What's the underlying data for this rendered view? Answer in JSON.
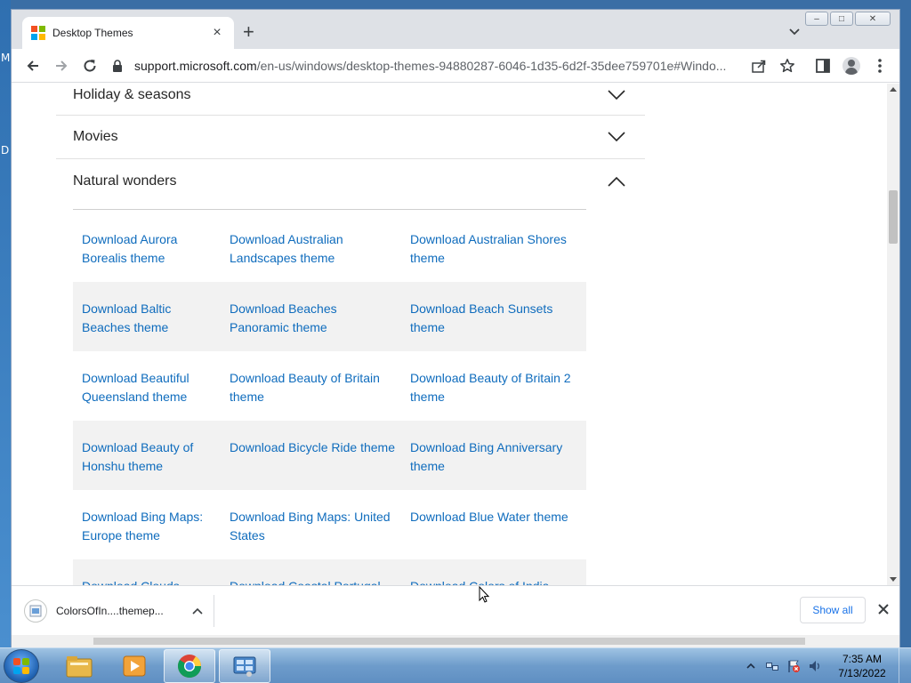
{
  "desktop": {
    "edge_glyph_1": "M",
    "edge_glyph_2": "D"
  },
  "browser": {
    "tab_title": "Desktop Themes",
    "new_tab_symbol": "+",
    "close_tab_symbol": "×",
    "url_host": "support.microsoft.com",
    "url_path": "/en-us/windows/desktop-themes-94880287-6046-1d35-6d2f-35dee759701e#Windo...",
    "window_buttons": [
      "–",
      "□",
      "✕"
    ]
  },
  "page": {
    "accordion_collapsed": [
      {
        "label": "Holiday & seasons"
      },
      {
        "label": "Movies"
      }
    ],
    "accordion_expanded": {
      "label": "Natural wonders"
    },
    "theme_rows": [
      [
        "Download Aurora Borealis theme",
        "Download Australian Landscapes theme",
        "Download Australian Shores theme"
      ],
      [
        "Download Baltic Beaches theme",
        "Download Beaches Panoramic theme",
        "Download Beach Sunsets theme"
      ],
      [
        "Download Beautiful Queensland theme",
        "Download Beauty of Britain theme",
        "Download Beauty of Britain 2 theme"
      ],
      [
        "Download Beauty of Honshu theme",
        "Download Bicycle Ride theme",
        "Download Bing Anniversary theme"
      ],
      [
        "Download Bing Maps: Europe theme",
        "Download Bing Maps: United States",
        "Download Blue Water theme"
      ],
      [
        "Download Clouds",
        "Download Coastal Portugal",
        "Download Colors of India"
      ]
    ]
  },
  "downloads": {
    "file_name": "ColorsOfIn....themep...",
    "show_all_label": "Show all"
  },
  "taskbar": {
    "time": "7:35 AM",
    "date": "7/13/2022"
  },
  "colors": {
    "link": "#0f6cbd",
    "accordion_text": "#262626",
    "shaded_row": "#f2f2f2",
    "chrome_frame": "#dee1e6"
  }
}
